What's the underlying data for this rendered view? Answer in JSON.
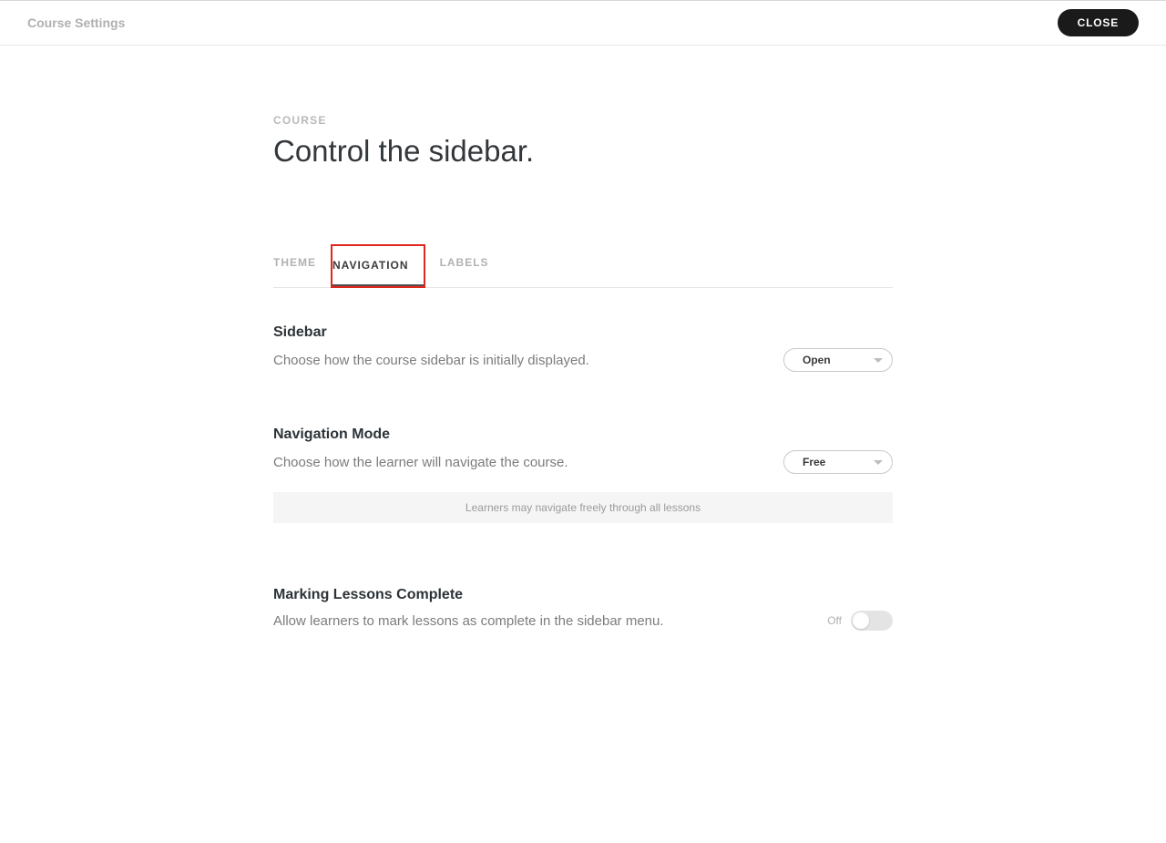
{
  "header": {
    "title": "Course Settings",
    "close": "CLOSE"
  },
  "page": {
    "eyebrow": "COURSE",
    "title": "Control the sidebar."
  },
  "tabs": {
    "theme": "THEME",
    "navigation": "NAVIGATION",
    "labels": "LABELS"
  },
  "sidebar": {
    "heading": "Sidebar",
    "desc": "Choose how the course sidebar is initially displayed.",
    "value": "Open"
  },
  "navmode": {
    "heading": "Navigation Mode",
    "desc": "Choose how the learner will navigate the course.",
    "value": "Free",
    "hint": "Learners may navigate freely through all lessons"
  },
  "marking": {
    "heading": "Marking Lessons Complete",
    "desc": "Allow learners to mark lessons as complete in the sidebar menu.",
    "state": "Off"
  }
}
